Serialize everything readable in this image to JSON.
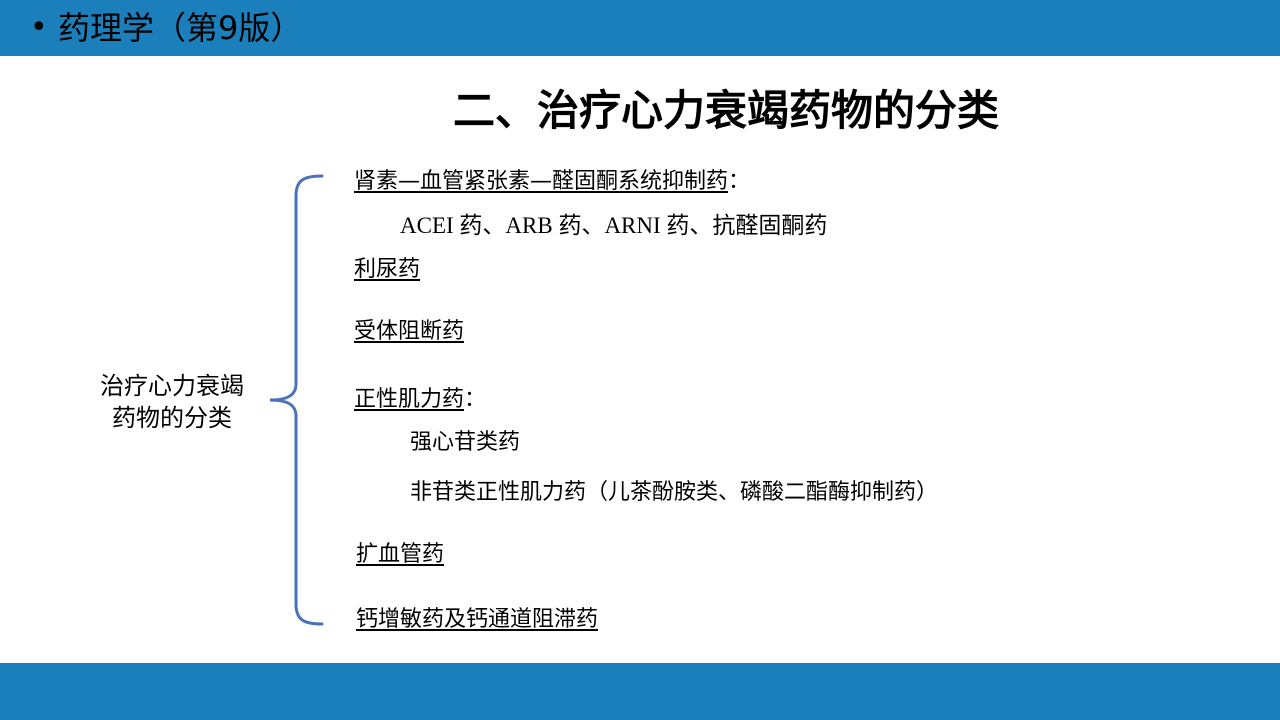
{
  "header": {
    "bullet": "•",
    "course_title": "药理学（第9版）"
  },
  "slide": {
    "title": "二、治疗心力衰竭药物的分类",
    "category_label_line1": "治疗心力衰竭",
    "category_label_line2": "药物的分类",
    "items": {
      "raas": {
        "label": "肾素—血管紧张素—醛固酮系统抑制药",
        "suffix": "："
      },
      "raas_sub": "ACEI 药、ARB 药、ARNI 药、抗醛固酮药",
      "diuretics": {
        "label": "利尿药"
      },
      "blockers": {
        "label": "受体阻断药"
      },
      "inotropes": {
        "label": "正性肌力药",
        "suffix": "："
      },
      "inotropes_sub1": "强心苷类药",
      "inotropes_sub2": "非苷类正性肌力药（儿茶酚胺类、磷酸二酯酶抑制药）",
      "vasodilators": {
        "label": "扩血管药"
      },
      "calcium": {
        "label": "钙增敏药及钙通道阻滞药"
      }
    }
  },
  "colors": {
    "bar": "#1a7fba",
    "brace": "#4a72b8"
  }
}
